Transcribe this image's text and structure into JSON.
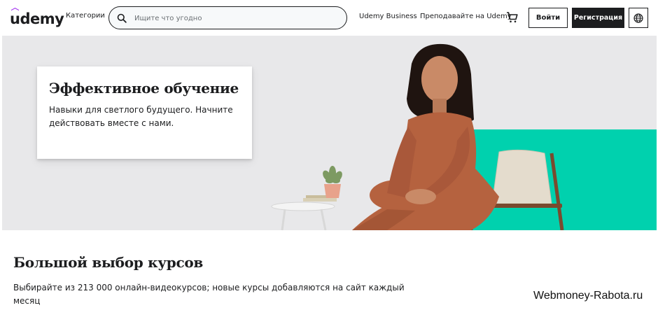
{
  "header": {
    "logo_text": "udemy",
    "categories_label": "Категории",
    "search_placeholder": "Ищите что угодно",
    "business_link": "Udemy Business",
    "teach_link": "Преподавайте на Udemy",
    "login_label": "Войти",
    "signup_label": "Регистрация",
    "icons": {
      "search": "search-icon",
      "cart": "cart-icon",
      "language": "globe-icon"
    }
  },
  "hero": {
    "title": "Эффективное обучение",
    "subtitle": "Навыки для светлого будущего. Начните действовать вместе с нами.",
    "colors": {
      "background": "#e8e8ea",
      "accent": "#00d1ae"
    }
  },
  "courses": {
    "title": "Большой выбор курсов",
    "text": "Выбирайте из 213 000 онлайн-видеокурсов; новые курсы добавляются на сайт каждый месяц"
  },
  "watermark": "Webmoney-Rabota.ru",
  "colors": {
    "brand_dark": "#1c1d1f",
    "brand_purple": "#a435f0"
  }
}
